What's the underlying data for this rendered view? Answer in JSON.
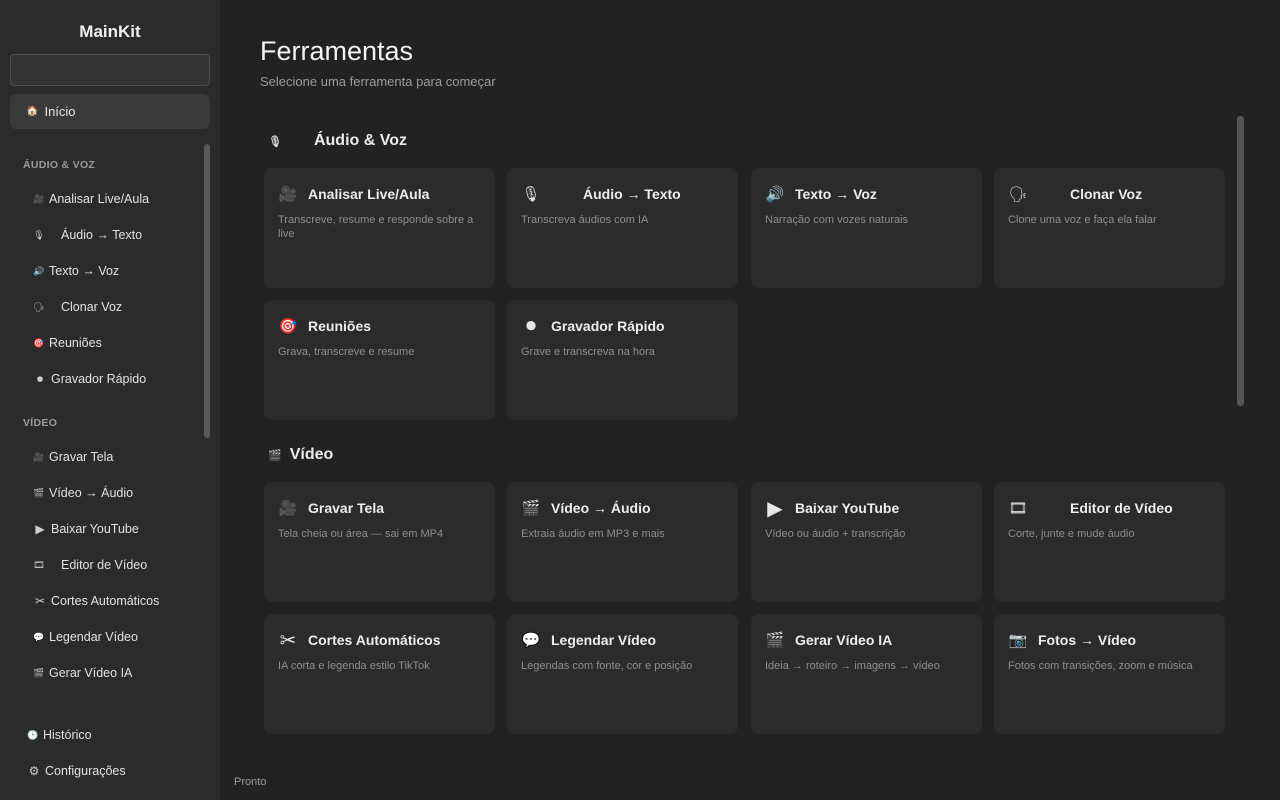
{
  "app": {
    "brand": "MainKit"
  },
  "sidebar": {
    "search_value": "",
    "home": {
      "icon": "🏠",
      "label": "Início"
    },
    "section_audio": "ÁUDIO & VOZ",
    "section_video": "VÍDEO",
    "items_audio": [
      {
        "icon": "🎥",
        "label": "Analisar Live/Aula"
      },
      {
        "icon": "🎙",
        "label": "Áudio → Texto"
      },
      {
        "icon": "🔊",
        "label": "Texto → Voz"
      },
      {
        "icon": "🗣",
        "label": "Clonar Voz"
      },
      {
        "icon": "🎯",
        "label": "Reuniões"
      },
      {
        "icon": "⏺",
        "label": "Gravador Rápido"
      }
    ],
    "items_video": [
      {
        "icon": "🎥",
        "label": "Gravar Tela"
      },
      {
        "icon": "🎬",
        "label": "Vídeo → Áudio"
      },
      {
        "icon": "▶",
        "label": "Baixar YouTube"
      },
      {
        "icon": "🎞",
        "label": "Editor de Vídeo"
      },
      {
        "icon": "✂",
        "label": "Cortes Automáticos"
      },
      {
        "icon": "💬",
        "label": "Legendar Vídeo"
      },
      {
        "icon": "🎬",
        "label": "Gerar Vídeo IA"
      }
    ],
    "historico": {
      "icon": "🕒",
      "label": "Histórico"
    },
    "config": {
      "icon": "⚙",
      "label": "Configurações"
    }
  },
  "main": {
    "title": "Ferramentas",
    "subtitle": "Selecione uma ferramenta para começar",
    "cat_audio": {
      "icon": "🎙",
      "label": "Áudio & Voz"
    },
    "cat_video": {
      "icon": "🎬",
      "label": "Vídeo"
    },
    "cards_audio": [
      {
        "icon": "🎥",
        "title": "Analisar Live/Aula",
        "desc": "Transcreve, resume e responde sobre a live"
      },
      {
        "icon": "🎙",
        "title": "Áudio → Texto",
        "desc": "Transcreva áudios com IA"
      },
      {
        "icon": "🔊",
        "title": "Texto → Voz",
        "desc": "Narração com vozes naturais"
      },
      {
        "icon": "🗣",
        "title": "Clonar Voz",
        "desc": "Clone uma voz e faça ela falar"
      },
      {
        "icon": "🎯",
        "title": "Reuniões",
        "desc": "Grava, transcreve e resume"
      },
      {
        "icon": "⏺",
        "title": "Gravador Rápido",
        "desc": "Grave e transcreva na hora"
      }
    ],
    "cards_video": [
      {
        "icon": "🎥",
        "title": "Gravar Tela",
        "desc": "Tela cheia ou área — sai em MP4"
      },
      {
        "icon": "🎬",
        "title": "Vídeo → Áudio",
        "desc": "Extraia áudio em MP3 e mais"
      },
      {
        "icon": "▶",
        "title": "Baixar YouTube",
        "desc": "Vídeo ou áudio + transcrição"
      },
      {
        "icon": "🎞",
        "title": "Editor de Vídeo",
        "desc": "Corte, junte e mude áudio"
      },
      {
        "icon": "✂",
        "title": "Cortes Automáticos",
        "desc": "IA corta e legenda estilo TikTok"
      },
      {
        "icon": "💬",
        "title": "Legendar Vídeo",
        "desc": "Legendas com fonte, cor e posição"
      },
      {
        "icon": "🎬",
        "title": "Gerar Vídeo IA",
        "desc": "Ideia → roteiro → imagens → vídeo"
      },
      {
        "icon": "📷",
        "title": "Fotos → Vídeo",
        "desc": "Fotos com transições, zoom e música"
      }
    ]
  },
  "status": "Pronto"
}
